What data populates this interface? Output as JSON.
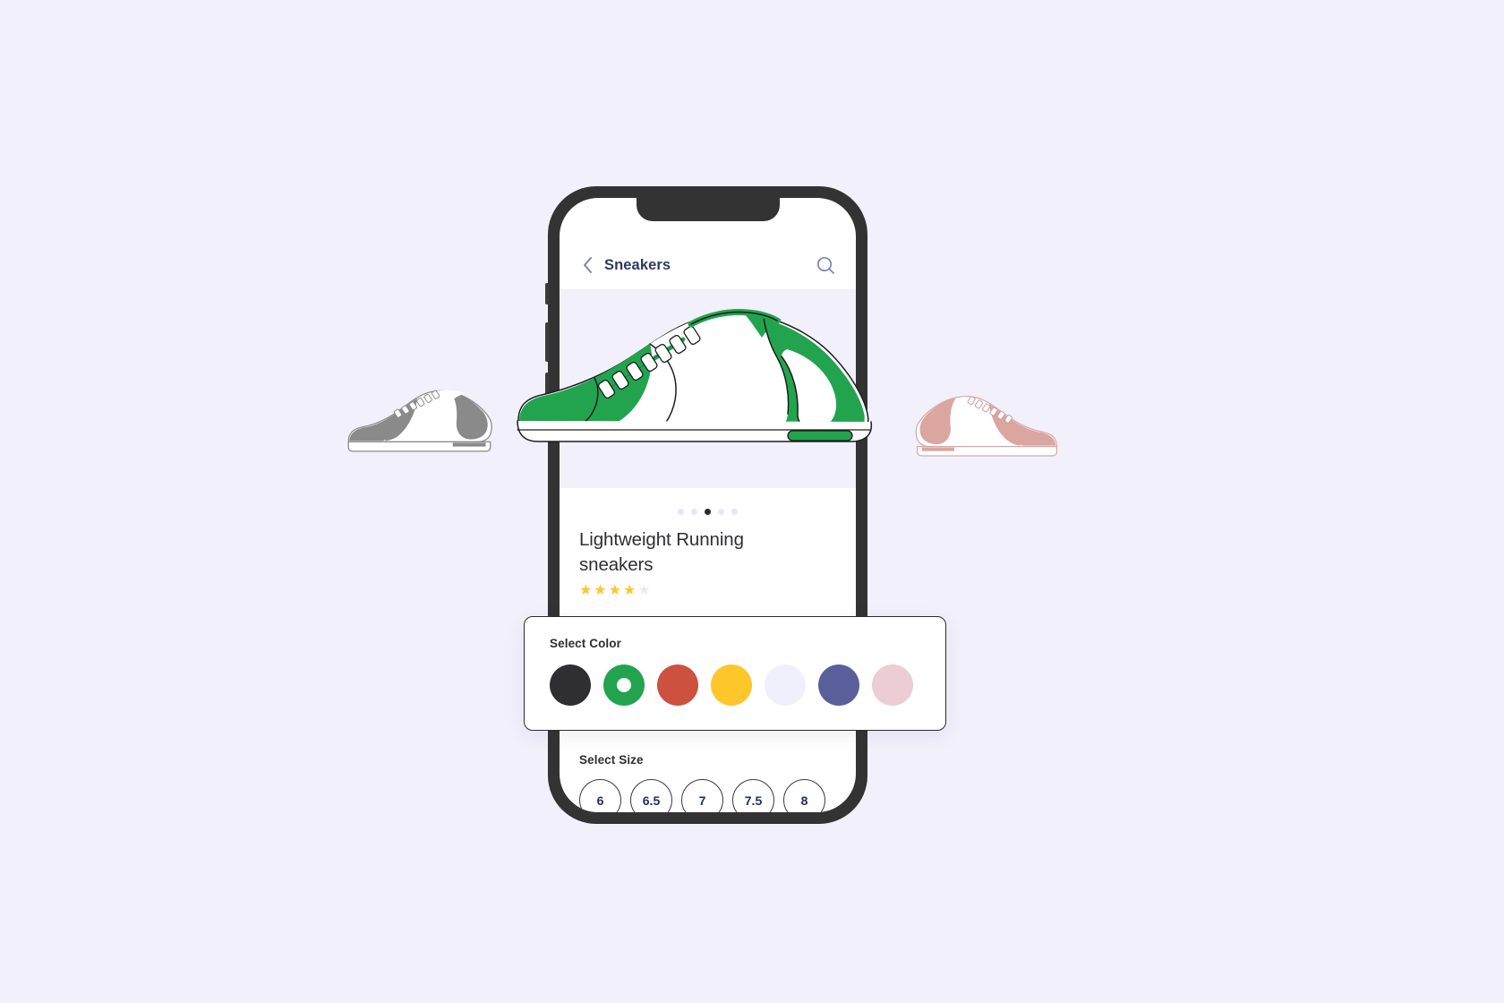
{
  "theme": {
    "background": "#f1f0fb",
    "phone_frame": "#333333",
    "accent_green": "#2ba14f",
    "title_navy": "#2c3a69",
    "star_gold": "#ffc629"
  },
  "header": {
    "back_label": "Back",
    "title": "Sneakers",
    "search_label": "Search"
  },
  "gallery": {
    "dots": [
      {
        "active": false
      },
      {
        "active": false
      },
      {
        "active": true
      },
      {
        "active": false
      },
      {
        "active": false
      }
    ],
    "hero_alt": "Green and white lightweight running sneaker"
  },
  "product": {
    "title": "Lightweight Running sneakers",
    "rating": 4,
    "rating_max": 5,
    "star_glyph": "★"
  },
  "color_section": {
    "label": "Select Color",
    "swatches": [
      {
        "name": "black",
        "hex": "#2f2f31",
        "selected": false
      },
      {
        "name": "green",
        "hex": "#22a44f",
        "selected": true
      },
      {
        "name": "brick-red",
        "hex": "#cc523f",
        "selected": false
      },
      {
        "name": "yellow",
        "hex": "#fdc62b",
        "selected": false
      },
      {
        "name": "pale-lavender",
        "hex": "#f0f0fc",
        "selected": false
      },
      {
        "name": "slate-blue",
        "hex": "#5a5f9b",
        "selected": false
      },
      {
        "name": "pale-pink",
        "hex": "#eccdd3",
        "selected": false
      }
    ]
  },
  "size_section": {
    "label": "Select Size",
    "sizes": [
      {
        "value": "6"
      },
      {
        "value": "6.5"
      },
      {
        "value": "7"
      },
      {
        "value": "7.5"
      },
      {
        "value": "8"
      }
    ]
  },
  "decor": {
    "left_shoe_alt": "Gray sneaker illustration",
    "right_shoe_alt": "Pink sneaker illustration"
  }
}
